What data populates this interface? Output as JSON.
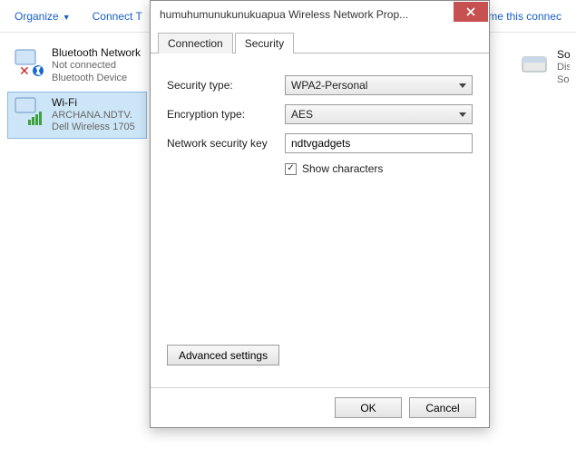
{
  "toolbar": {
    "organize": "Organize",
    "connect_to": "Connect T",
    "rename": "hame this connec"
  },
  "network_list": {
    "left": [
      {
        "title": "Bluetooth Network",
        "line2": "Not connected",
        "line3": "Bluetooth Device"
      },
      {
        "title": "Wi-Fi",
        "line2": "ARCHANA.NDTV.",
        "line3": "Dell Wireless 1705"
      }
    ],
    "right": [
      {
        "title": "SonicWALL I",
        "line2": "Disconnecte",
        "line3": "SonicWALL I"
      }
    ]
  },
  "dialog": {
    "title": "humuhumunukunukuapua Wireless Network Prop...",
    "tabs": {
      "connection": "Connection",
      "security": "Security"
    },
    "labels": {
      "security_type": "Security type:",
      "encryption_type": "Encryption type:",
      "network_key": "Network security key",
      "show_chars": "Show characters",
      "advanced": "Advanced settings",
      "ok": "OK",
      "cancel": "Cancel"
    },
    "values": {
      "security_type": "WPA2-Personal",
      "encryption_type": "AES",
      "network_key": "ndtvgadgets",
      "show_chars_checked": "✓"
    }
  }
}
